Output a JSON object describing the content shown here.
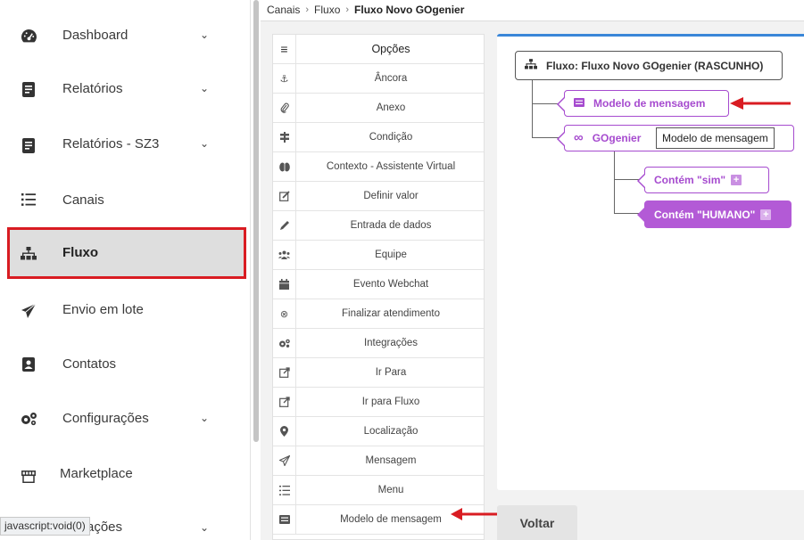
{
  "breadcrumb": {
    "items": [
      "Canais",
      "Fluxo"
    ],
    "current": "Fluxo Novo GOgenier"
  },
  "sidebar": {
    "items": [
      {
        "label": "Dashboard",
        "icon": "dashboard-icon",
        "has_chevron": true
      },
      {
        "label": "Relatórios",
        "icon": "report-icon",
        "has_chevron": true
      },
      {
        "label": "Relatórios - SZ3",
        "icon": "report-icon",
        "has_chevron": true
      },
      {
        "label": "Canais",
        "icon": "list-icon",
        "has_chevron": false
      },
      {
        "label": "Fluxo",
        "icon": "sitemap-icon",
        "has_chevron": false,
        "active": true
      },
      {
        "label": "Envio em lote",
        "icon": "paper-plane-icon",
        "has_chevron": false
      },
      {
        "label": "Contatos",
        "icon": "contact-card-icon",
        "has_chevron": false
      },
      {
        "label": "Configurações",
        "icon": "cogs-icon",
        "has_chevron": true
      },
      {
        "label": "Marketplace",
        "icon": "store-icon",
        "has_chevron": false
      },
      {
        "label": "ações",
        "icon": "",
        "has_chevron": true
      }
    ],
    "chevron": "⌄"
  },
  "status_tip": "javascript:void(0)",
  "options": {
    "header": "Opções",
    "items": [
      "Âncora",
      "Anexo",
      "Condição",
      "Contexto - Assistente Virtual",
      "Definir valor",
      "Entrada de dados",
      "Equipe",
      "Evento Webchat",
      "Finalizar atendimento",
      "Integrações",
      "Ir Para",
      "Ir para Fluxo",
      "Localização",
      "Mensagem",
      "Menu",
      "Modelo de mensagem"
    ]
  },
  "flow": {
    "root": "Fluxo: Fluxo Novo GOgenier (RASCUNHO)",
    "node_model": "Modelo de mensagem",
    "node_gogenier": "GOgenier",
    "branch_sim": "Contém \"sim\"",
    "branch_humano": "Contém \"HUMANO\"",
    "tooltip": "Modelo de mensagem"
  },
  "buttons": {
    "back": "Voltar"
  },
  "colors": {
    "accent": "#3a86d8",
    "node_purple": "#a64bcf",
    "highlight_red": "#d91c22"
  }
}
